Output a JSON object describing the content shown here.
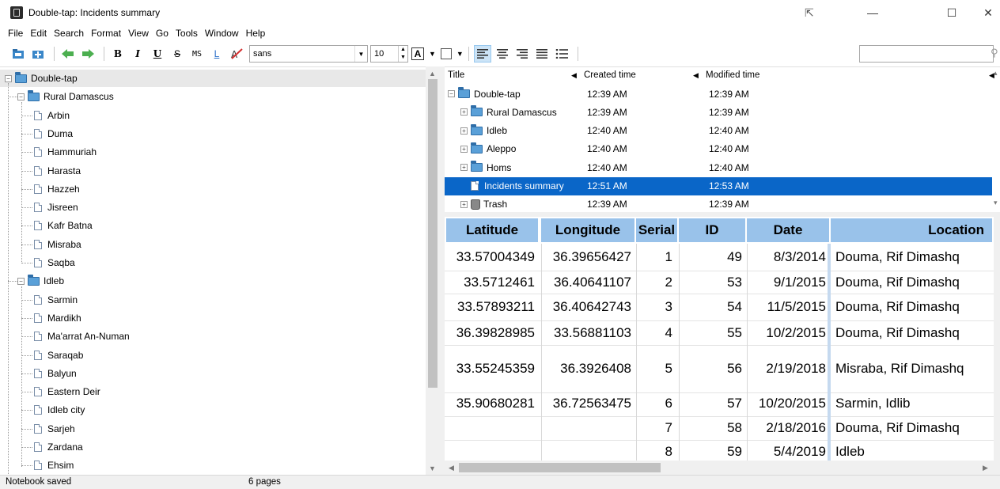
{
  "window": {
    "title": "Double-tap: Incidents summary",
    "minimize": "—",
    "maximize": "☐",
    "close": "✕"
  },
  "menu": [
    "File",
    "Edit",
    "Search",
    "Format",
    "View",
    "Go",
    "Tools",
    "Window",
    "Help"
  ],
  "toolbar": {
    "bold": "B",
    "italic": "I",
    "underline": "U",
    "strike": "S",
    "mono": "MS",
    "link": "L",
    "font": "sans",
    "size": "10",
    "color_glyph": "A"
  },
  "tree": {
    "root": "Double-tap",
    "groups": [
      {
        "label": "Rural Damascus",
        "children": [
          "Arbin",
          "Duma",
          "Hammuriah",
          "Harasta",
          "Hazzeh",
          "Jisreen",
          "Kafr Batna",
          "Misraba",
          "Saqba"
        ]
      },
      {
        "label": "Idleb",
        "children": [
          "Sarmin",
          "Mardikh",
          "Ma'arrat An-Numan",
          "Saraqab",
          "Balyun",
          "Eastern Deir",
          "Idleb city",
          "Sarjeh",
          "Zardana",
          "Ehsim"
        ]
      }
    ]
  },
  "list": {
    "headers": [
      "Title",
      "Created time",
      "Modified time"
    ],
    "rows": [
      {
        "title": "Double-tap",
        "created": "12:39 AM",
        "modified": "12:39 AM"
      },
      {
        "title": "Rural Damascus",
        "created": "12:39 AM",
        "modified": "12:39 AM"
      },
      {
        "title": "Idleb",
        "created": "12:40 AM",
        "modified": "12:40 AM"
      },
      {
        "title": "Aleppo",
        "created": "12:40 AM",
        "modified": "12:40 AM"
      },
      {
        "title": "Homs",
        "created": "12:40 AM",
        "modified": "12:40 AM"
      },
      {
        "title": "Incidents summary",
        "created": "12:51 AM",
        "modified": "12:53 AM"
      },
      {
        "title": "Trash",
        "created": "12:39 AM",
        "modified": "12:39 AM"
      }
    ]
  },
  "table": {
    "headers": [
      "Latitude",
      "Longitude",
      "Serial",
      "ID",
      "Date",
      "Location"
    ],
    "rows": [
      [
        "33.57004349",
        "36.39656427",
        "1",
        "49",
        "8/3/2014",
        "Douma, Rif Dimashq"
      ],
      [
        "33.5712461",
        "36.40641107",
        "2",
        "53",
        "9/1/2015",
        "Douma, Rif Dimashq"
      ],
      [
        "33.57893211",
        "36.40642743",
        "3",
        "54",
        "11/5/2015",
        "Douma, Rif Dimashq"
      ],
      [
        "36.39828985",
        "33.56881103",
        "4",
        "55",
        "10/2/2015",
        "Douma, Rif Dimashq"
      ],
      [
        "33.55245359",
        "36.3926408",
        "5",
        "56",
        "2/19/2018",
        "Misraba, Rif Dimashq"
      ],
      [
        "35.90680281",
        "36.72563475",
        "6",
        "57",
        "10/20/2015",
        "Sarmin, Idlib"
      ],
      [
        "",
        "",
        "7",
        "58",
        "2/18/2016",
        "Douma, Rif Dimashq"
      ],
      [
        "",
        "",
        "8",
        "59",
        "5/4/2019",
        "Idleb"
      ]
    ]
  },
  "status": {
    "message": "Notebook saved",
    "pages": "6 pages"
  },
  "colors": {
    "selection": "#0a66c8",
    "table_header": "#99c2ea",
    "folder": "#5aa0d8"
  }
}
